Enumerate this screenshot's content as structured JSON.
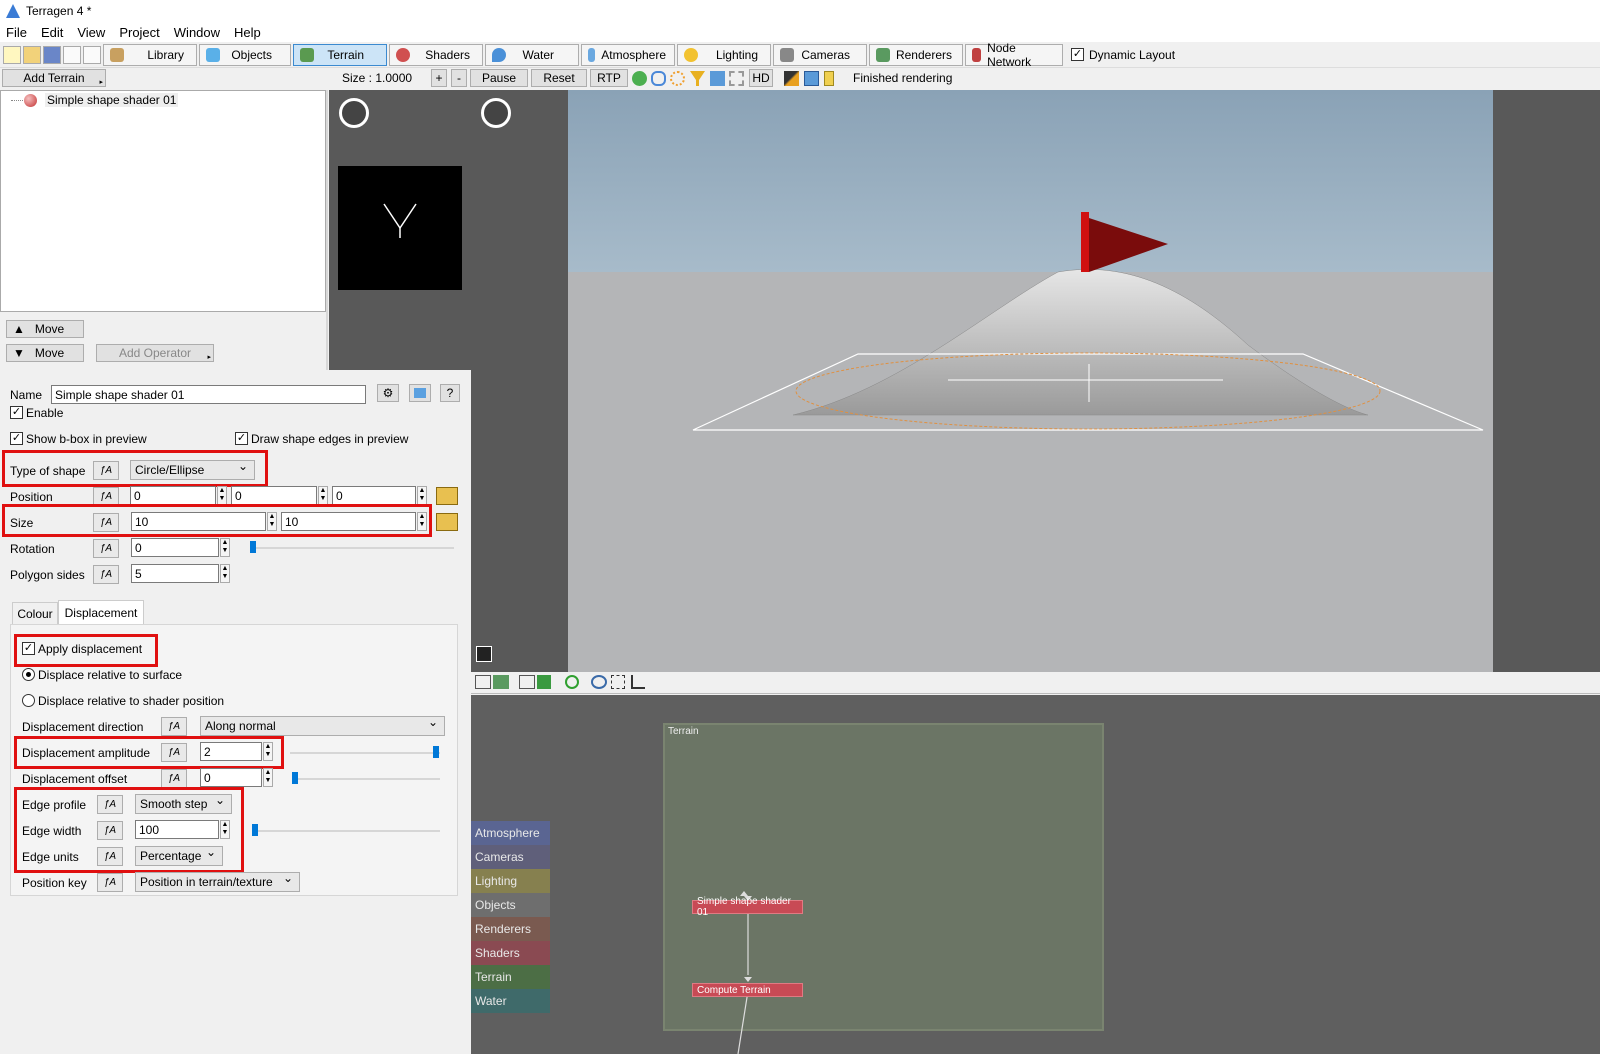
{
  "window": {
    "title": "Terragen 4 *"
  },
  "menu": [
    "File",
    "Edit",
    "View",
    "Project",
    "Window",
    "Help"
  ],
  "toolbar": {
    "tabs": [
      {
        "label": "Library",
        "icon": "library-icon"
      },
      {
        "label": "Objects",
        "icon": "cube-icon"
      },
      {
        "label": "Terrain",
        "icon": "terrain-icon",
        "active": true
      },
      {
        "label": "Shaders",
        "icon": "sphere-icon"
      },
      {
        "label": "Water",
        "icon": "drop-icon"
      },
      {
        "label": "Atmosphere",
        "icon": "cloud-icon"
      },
      {
        "label": "Lighting",
        "icon": "sun-icon"
      },
      {
        "label": "Cameras",
        "icon": "camera-icon"
      },
      {
        "label": "Renderers",
        "icon": "image-icon"
      },
      {
        "label": "Node Network",
        "icon": "network-icon"
      }
    ],
    "dynamic_layout": "Dynamic Layout"
  },
  "terrain_panel": {
    "add_terrain": "Add Terrain",
    "tree_items": [
      "Simple shape shader 01"
    ],
    "move_up": "Move",
    "move_down": "Move",
    "add_operator": "Add Operator"
  },
  "preview_bar": {
    "size_label": "Size : 1.0000",
    "plus": "+",
    "minus": "-",
    "pause": "Pause",
    "reset": "Reset",
    "rtp": "RTP",
    "hd": "HD",
    "status": "Finished rendering"
  },
  "props": {
    "name_label": "Name",
    "name_value": "Simple shape shader 01",
    "help": "?",
    "enable": "Enable",
    "show_bbox": "Show b-box in preview",
    "draw_edges": "Draw shape edges in preview",
    "type_of_shape_label": "Type of shape",
    "type_of_shape_value": "Circle/Ellipse",
    "position_label": "Position",
    "position_values": [
      "0",
      "0",
      "0"
    ],
    "size_label": "Size",
    "size_values": [
      "10",
      "10"
    ],
    "rotation_label": "Rotation",
    "rotation_value": "0",
    "polygon_sides_label": "Polygon sides",
    "polygon_sides_value": "5",
    "tab_colour": "Colour",
    "tab_displacement": "Displacement",
    "apply_displacement": "Apply displacement",
    "displace_surface": "Displace relative to surface",
    "displace_shader": "Displace relative to shader position",
    "disp_direction_label": "Displacement direction",
    "disp_direction_value": "Along normal",
    "disp_amplitude_label": "Displacement amplitude",
    "disp_amplitude_value": "2",
    "disp_offset_label": "Displacement offset",
    "disp_offset_value": "0",
    "edge_profile_label": "Edge profile",
    "edge_profile_value": "Smooth step",
    "edge_width_label": "Edge width",
    "edge_width_value": "100",
    "edge_units_label": "Edge units",
    "edge_units_value": "Percentage",
    "position_key_label": "Position key",
    "position_key_value": "Position in terrain/texture"
  },
  "node_network": {
    "group_title": "Terrain",
    "categories": [
      {
        "label": "Atmosphere",
        "color": "#5a6592"
      },
      {
        "label": "Cameras",
        "color": "#5f5f7a"
      },
      {
        "label": "Lighting",
        "color": "#86804f"
      },
      {
        "label": "Objects",
        "color": "#6e6e6e"
      },
      {
        "label": "Renderers",
        "color": "#7a5a50"
      },
      {
        "label": "Shaders",
        "color": "#8a4a52"
      },
      {
        "label": "Terrain",
        "color": "#4c6e45"
      },
      {
        "label": "Water",
        "color": "#3f6a6a"
      }
    ],
    "nodes": [
      "Simple shape shader 01",
      "Compute Terrain"
    ]
  }
}
